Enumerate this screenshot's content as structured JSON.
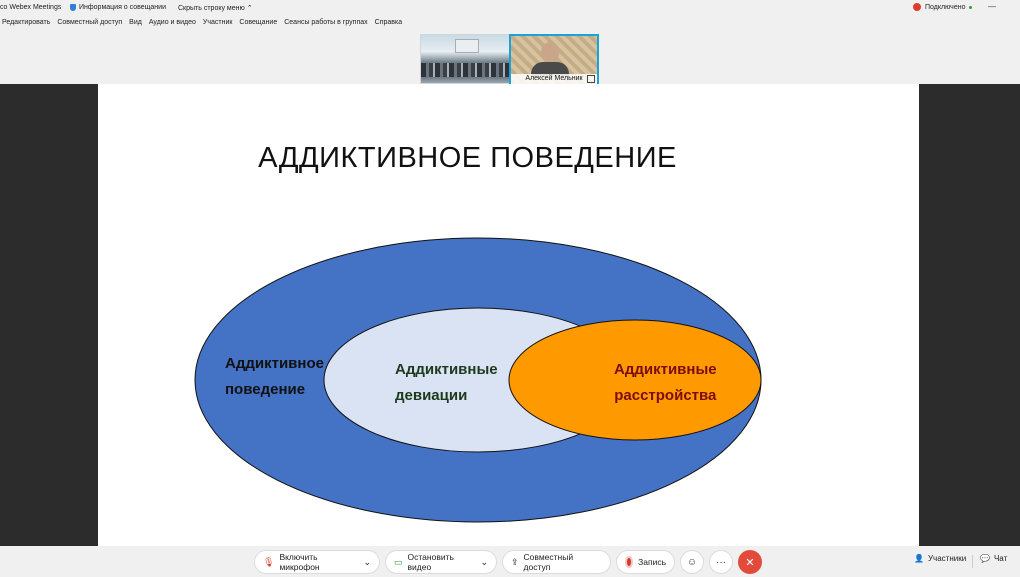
{
  "titlebar": {
    "app_name": "co Webex Meetings",
    "meeting_info": "Информация о совещании",
    "hide_menu": "Скрыть строку меню",
    "connection_status": "Подключено",
    "minimize_glyph": "—"
  },
  "menu": [
    "Редактировать",
    "Совместный доступ",
    "Вид",
    "Аудио и видео",
    "Участник",
    "Совещание",
    "Сеансы работы в группах",
    "Справка"
  ],
  "participants": {
    "thumbnail_2_name": "Алексей Мельник"
  },
  "slide": {
    "title": "АДДИКТИВНОЕ ПОВЕДЕНИЕ",
    "outer_label_line1": "Аддиктивное",
    "outer_label_line2": "поведение",
    "middle_label_line1": "Аддиктивные",
    "middle_label_line2": "девиации",
    "inner_label_line1": "Аддиктивные",
    "inner_label_line2": "расстройства",
    "colors": {
      "outer": "#4472c4",
      "middle": "#dae3f3",
      "inner": "#ff9900",
      "outline": "#111111"
    }
  },
  "toolbar": {
    "mic_button": "Включить микрофон",
    "video_button": "Остановить видео",
    "share_button": "Совместный доступ",
    "record_button": "Запись",
    "more_glyph": "···",
    "participants_button": "Участники",
    "chat_button": "Чат"
  }
}
